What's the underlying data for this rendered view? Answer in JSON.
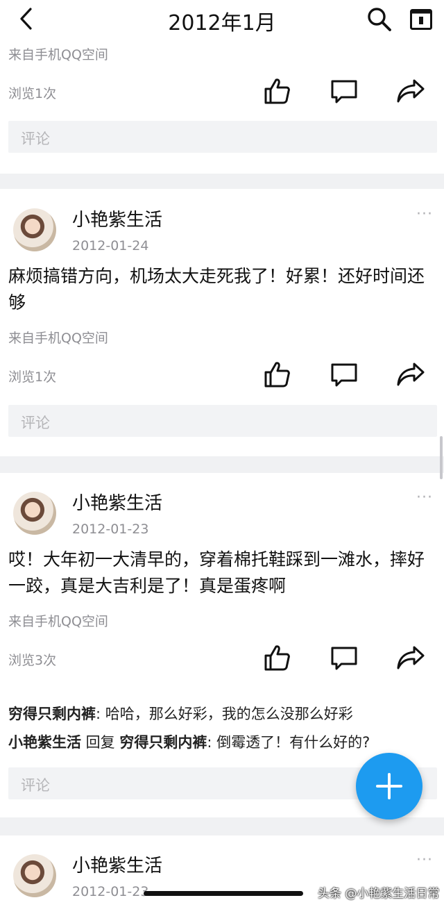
{
  "header": {
    "title": "2012年1月",
    "back_icon": "chevron-left-icon",
    "search_icon": "search-icon",
    "calendar_icon": "calendar-icon"
  },
  "posts": [
    {
      "source": "来自手机QQ空间",
      "views": "浏览1次",
      "comment_placeholder": "评论"
    },
    {
      "author": "小艳紫生活",
      "date": "2012-01-24",
      "text": "麻烦搞错方向，机场太大走死我了！好累！还好时间还够",
      "source": "来自手机QQ空间",
      "views": "浏览1次",
      "comment_placeholder": "评论"
    },
    {
      "author": "小艳紫生活",
      "date": "2012-01-23",
      "text": "哎！大年初一大清早的，穿着棉托鞋踩到一滩水，摔好一跤，真是大吉利是了！真是蛋疼啊",
      "source": "来自手机QQ空间",
      "views": "浏览3次",
      "comments": [
        {
          "user": "穷得只剩内裤",
          "text": ": 哈哈，那么好彩，我的怎么没那么好彩"
        },
        {
          "user": "小艳紫生活",
          "verb": " 回复 ",
          "target": "穷得只剩内裤",
          "text": ": 倒霉透了！有什么好的?"
        }
      ],
      "comment_placeholder": "评论"
    },
    {
      "author": "小艳紫生活",
      "date": "2012-01-23"
    }
  ],
  "more_label": "···",
  "fab_icon": "plus-icon",
  "watermark": "头条 @小艳紫生活日常",
  "colors": {
    "accent": "#1d9bf0",
    "muted": "#8e8e93"
  }
}
